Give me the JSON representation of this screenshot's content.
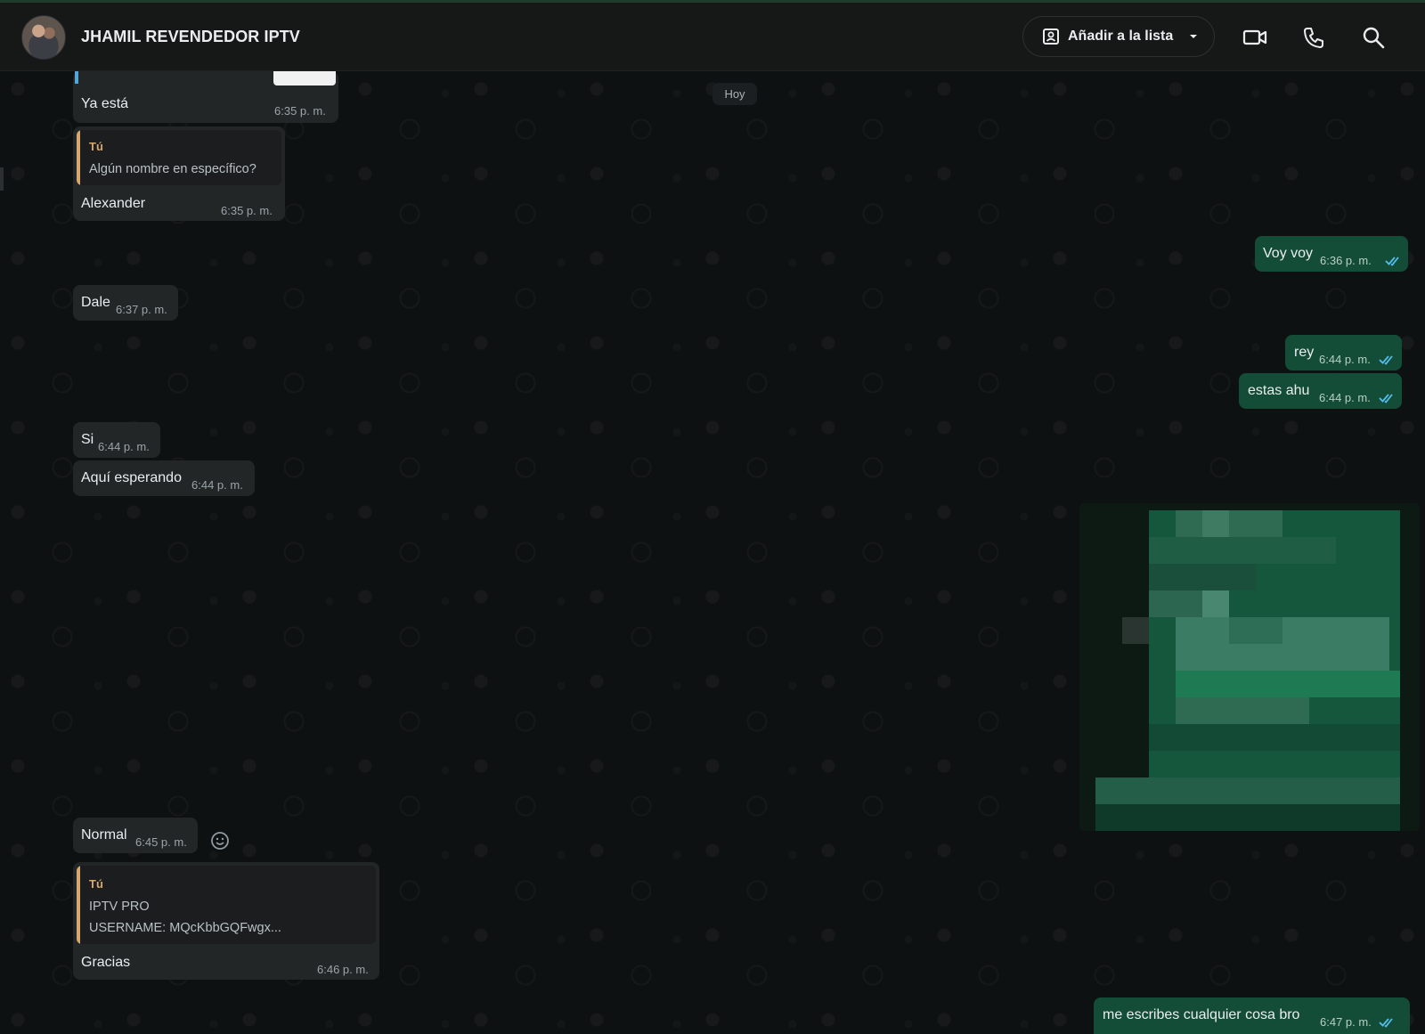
{
  "header": {
    "contact_name": "JHAMIL REVENDEDOR IPTV",
    "add_to_list_label": "Añadir a la lista",
    "icons": [
      "avatar",
      "list-add-icon",
      "chevron-down-icon",
      "video-call-icon",
      "phone-icon",
      "search-icon"
    ]
  },
  "chat": {
    "date_divider": "Hoy",
    "messages": [
      {
        "dir": "in",
        "text": "Ya está",
        "time": "6:35 p. m."
      },
      {
        "dir": "in",
        "quote_author": "Tú",
        "quote_text": "Algún nombre en específico?",
        "text": "Alexander",
        "time": "6:35 p. m."
      },
      {
        "dir": "out",
        "text": "Voy voy",
        "time": "6:36 p. m.",
        "status": "read"
      },
      {
        "dir": "in",
        "text": "Dale",
        "time": "6:37 p. m."
      },
      {
        "dir": "out",
        "text": "rey",
        "time": "6:44 p. m.",
        "status": "read"
      },
      {
        "dir": "out",
        "text": "estas ahu",
        "time": "6:44 p. m.",
        "status": "read"
      },
      {
        "dir": "in",
        "text": "Si",
        "time": "6:44 p. m."
      },
      {
        "dir": "in",
        "text": "Aquí esperando",
        "time": "6:44 p. m."
      },
      {
        "dir": "out",
        "type": "image",
        "description": "pixelated image"
      },
      {
        "dir": "in",
        "text": "Normal",
        "time": "6:45 p. m."
      },
      {
        "dir": "in",
        "quote_author": "Tú",
        "quote_text": "IPTV PRO",
        "quote_text2": "USERNAME: MQcKbbGQFwgx...",
        "text": "Gracias",
        "time": "6:46 p. m."
      },
      {
        "dir": "out",
        "text": "me escribes cualquier cosa bro",
        "time": "6:47 p. m.",
        "status": "read"
      }
    ]
  },
  "colors": {
    "header_bg": "#161717",
    "incoming_bubble": "#232627",
    "outgoing_bubble": "#144d37",
    "quote_accent": "#d7a86e",
    "read_ticks": "#53bdeb"
  }
}
